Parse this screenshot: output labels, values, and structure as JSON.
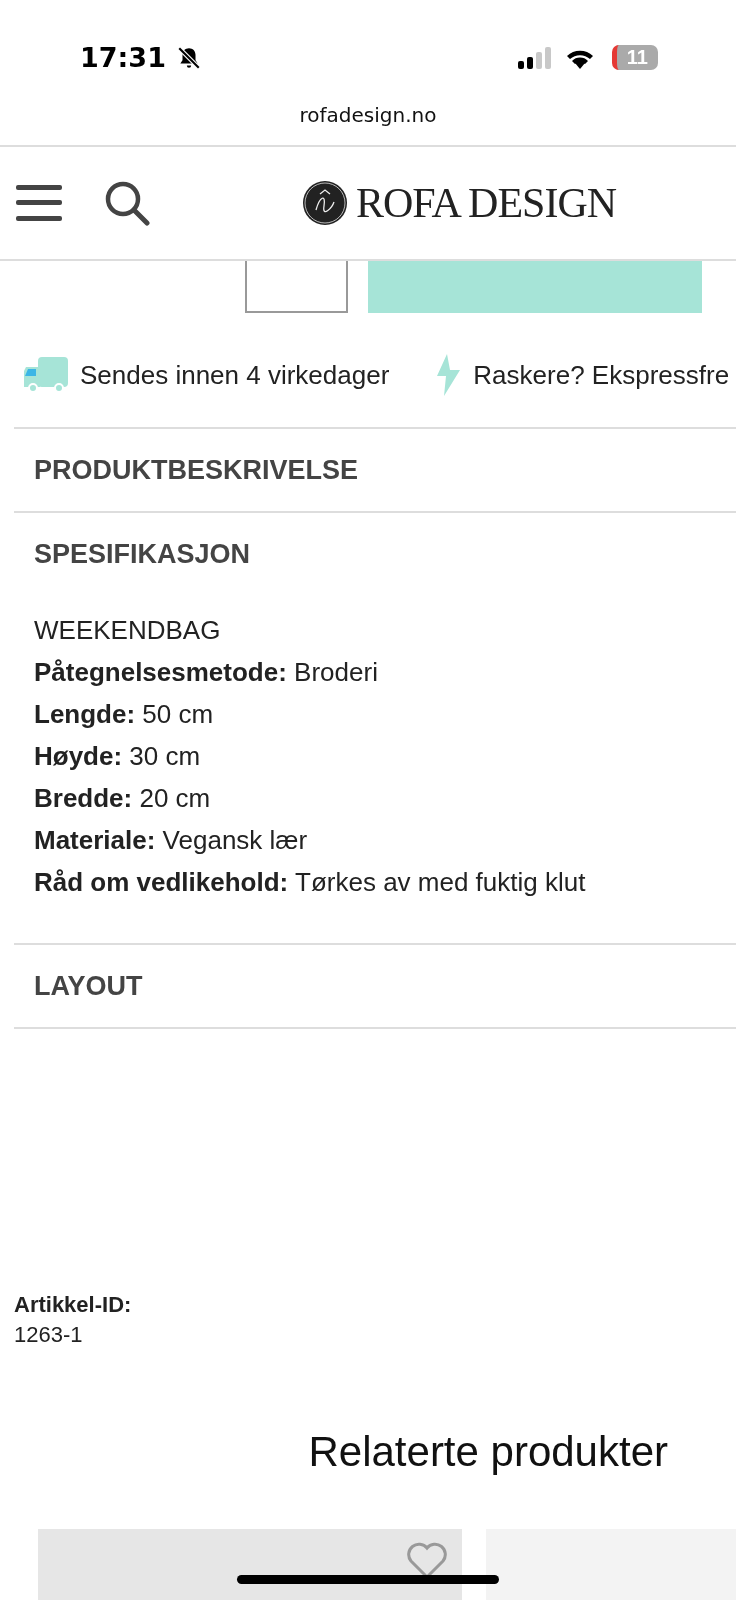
{
  "status_bar": {
    "time": "17:31",
    "silent": true,
    "battery": "11"
  },
  "browser": {
    "url": "rofadesign.no"
  },
  "header": {
    "logo": "ROFA DESIGN"
  },
  "delivery": [
    {
      "kind": "truck",
      "text": "Sendes innen 4 virkedager"
    },
    {
      "kind": "bolt",
      "text": "Raskere? Ekspressfre"
    }
  ],
  "sections": [
    {
      "title": "PRODUKTBESKRIVELSE"
    },
    {
      "title": "SPESIFIKASJON",
      "lines": [
        "WEEKENDBAG",
        "**Påtegnelsesmetode:** Broderi",
        "**Lengde:** 50 cm",
        "**Høyde:** 30 cm",
        "**Bredde:** 20 cm",
        "**Materiale:** Vegansk lær",
        "**Råd om vedlikehold:** Tørkes av med fuktig klut"
      ]
    },
    {
      "title": "LAYOUT"
    }
  ],
  "article": {
    "label": "Artikkel-ID:",
    "value": "1263-1"
  },
  "related": {
    "title": "Relaterte produkter"
  }
}
